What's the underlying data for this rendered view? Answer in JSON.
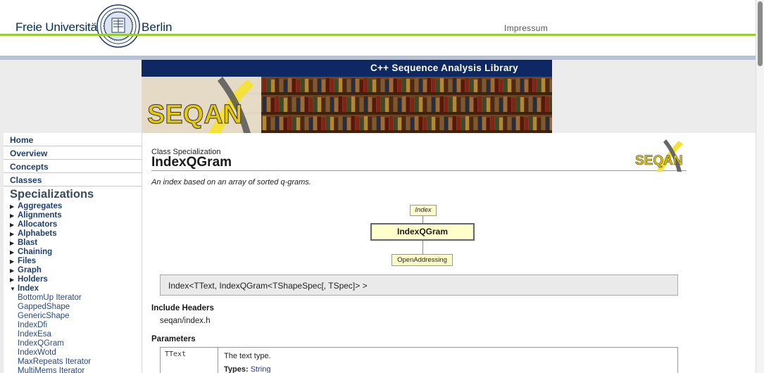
{
  "header": {
    "university_left": "Freie Universität",
    "university_right": "Berlin",
    "impressum": "Impressum"
  },
  "banner": {
    "tagline": "C++ Sequence Analysis Library",
    "logo_text": "SEQAN"
  },
  "nav": {
    "main_links": [
      {
        "label": "Home"
      },
      {
        "label": "Overview"
      },
      {
        "label": "Concepts"
      },
      {
        "label": "Classes"
      }
    ],
    "section_heading": "Specializations",
    "groups": [
      {
        "label": "Aggregates",
        "expanded": false
      },
      {
        "label": "Alignments",
        "expanded": false
      },
      {
        "label": "Allocators",
        "expanded": false
      },
      {
        "label": "Alphabets",
        "expanded": false
      },
      {
        "label": "Blast",
        "expanded": false
      },
      {
        "label": "Chaining",
        "expanded": false
      },
      {
        "label": "Files",
        "expanded": false
      },
      {
        "label": "Graph",
        "expanded": false
      },
      {
        "label": "Holders",
        "expanded": false
      },
      {
        "label": "Index",
        "expanded": true
      }
    ],
    "index_children": [
      {
        "label": "BottomUp Iterator"
      },
      {
        "label": "GappedShape"
      },
      {
        "label": "GenericShape"
      },
      {
        "label": "IndexDfi"
      },
      {
        "label": "IndexEsa"
      },
      {
        "label": "IndexQGram"
      },
      {
        "label": "IndexWotd"
      },
      {
        "label": "MaxRepeats Iterator"
      },
      {
        "label": "MultiMems Iterator"
      }
    ]
  },
  "content": {
    "kind": "Class Specialization",
    "title": "IndexQGram",
    "logo_text": "SEQAN",
    "description": "An index based on an array of sorted q-grams.",
    "diagram": {
      "parent": "Index",
      "current": "IndexQGram",
      "child": "OpenAddressing"
    },
    "signature": "Index<TText, IndexQGram<TShapeSpec[, TSpec]> >",
    "include_headers_title": "Include Headers",
    "include_header": "seqan/index.h",
    "parameters_title": "Parameters",
    "parameters": [
      {
        "name": "TText",
        "description": "The text type.",
        "types_label": "Types:",
        "types_value": "String"
      }
    ]
  },
  "colors": {
    "green_line": "#99cc33",
    "banner_bar": "#0e2863",
    "link": "#1e3f6e",
    "node_fill": "#ffffcc"
  }
}
